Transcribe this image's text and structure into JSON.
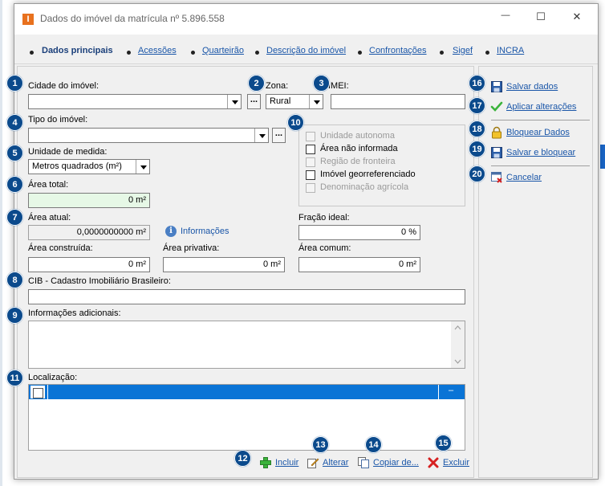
{
  "window": {
    "title": "Dados do imóvel da matrícula nº 5.896.558",
    "app_icon_letter": "I",
    "minimize_glyph": "—",
    "maximize_glyph": "☐",
    "close_glyph": "✕"
  },
  "tabs": [
    {
      "label": "Dados principais",
      "active": true
    },
    {
      "label": "Acessões"
    },
    {
      "label": "Quarteirão"
    },
    {
      "label": "Descrição do imóvel"
    },
    {
      "label": "Confrontações"
    },
    {
      "label": "Sigef"
    },
    {
      "label": "INCRA"
    }
  ],
  "badges": [
    "1",
    "2",
    "3",
    "4",
    "5",
    "6",
    "7",
    "8",
    "9",
    "10",
    "11",
    "12",
    "13",
    "14",
    "15",
    "16",
    "17",
    "18",
    "19",
    "20"
  ],
  "form": {
    "cidade_label": "Cidade do imóvel:",
    "cidade_value": "",
    "zona_label": "Zona:",
    "zona_value": "Rural",
    "imei_label": "IMEI:",
    "imei_value": "",
    "tipo_label": "Tipo do imóvel:",
    "tipo_value": "",
    "unidade_label": "Unidade de medida:",
    "unidade_value": "Metros quadrados (m²)",
    "area_total_label": "Área total:",
    "area_total_value": "0 m²",
    "area_atual_label": "Área atual:",
    "area_atual_value": "0,0000000000 m²",
    "informacoes_link": "Informações",
    "fracao_label": "Fração ideal:",
    "fracao_value": "0 %",
    "area_construida_label": "Área construída:",
    "area_construida_value": "0 m²",
    "area_privativa_label": "Área privativa:",
    "area_privativa_value": "0 m²",
    "area_comum_label": "Área comum:",
    "area_comum_value": "0 m²",
    "cib_label": "CIB - Cadastro Imobiliário Brasileiro:",
    "cib_value": "",
    "info_adicionais_label": "Informações adicionais:",
    "localizacao_label": "Localização:",
    "ellipsis": "..."
  },
  "checkboxes": [
    {
      "label": "Unidade autonoma",
      "enabled": false,
      "checked": false
    },
    {
      "label": "Área não informada",
      "enabled": true,
      "checked": false
    },
    {
      "label": "Região de fronteira",
      "enabled": false,
      "checked": false
    },
    {
      "label": "Imóvel georreferenciado",
      "enabled": true,
      "checked": false
    },
    {
      "label": "Denominação agrícola",
      "enabled": false,
      "checked": false
    }
  ],
  "grid": {
    "cell_dash": "–"
  },
  "bottom_actions": {
    "incluir": "Incluir",
    "alterar": "Alterar",
    "copiar": "Copiar de...",
    "excluir": "Excluir"
  },
  "side_actions": {
    "salvar": "Salvar dados",
    "aplicar": "Aplicar alterações",
    "bloquear": "Bloquear Dados",
    "salvar_bloquear": "Salvar e bloquear",
    "cancelar": "Cancelar"
  },
  "colors": {
    "accent": "#0b4a8c",
    "link": "#1a56a8",
    "selection": "#0a74d6",
    "area_total_bg": "#e6f8e6"
  }
}
